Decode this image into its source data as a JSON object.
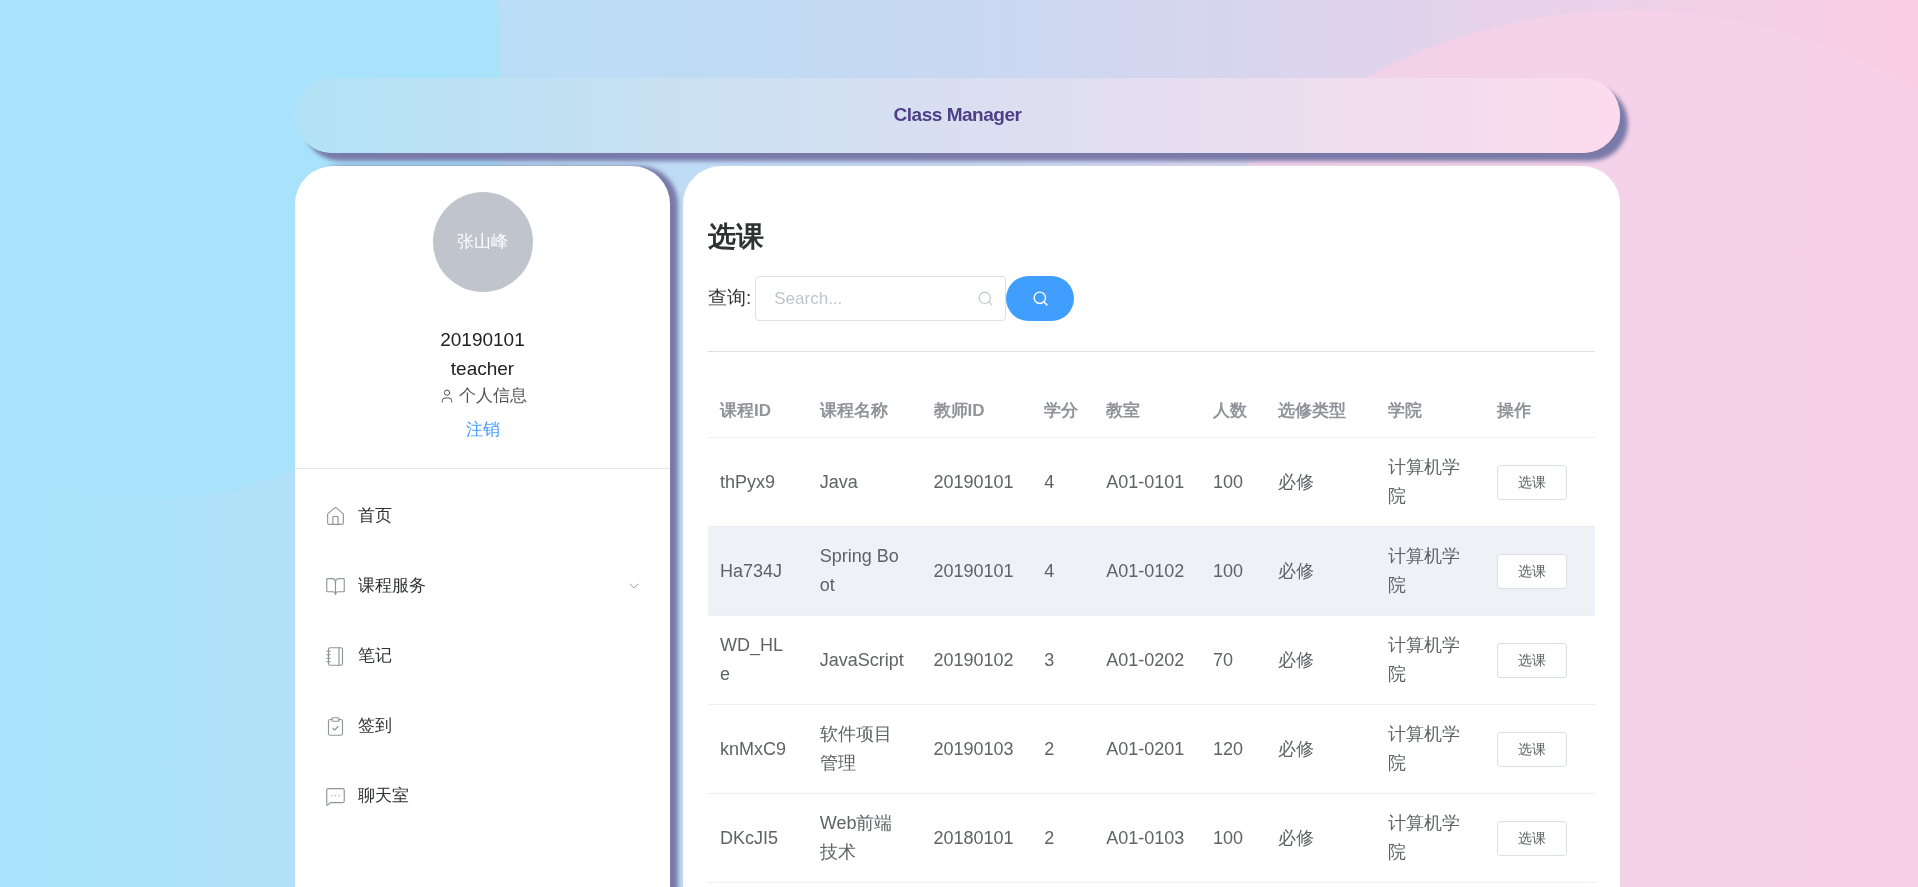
{
  "header": {
    "title": "Class Manager"
  },
  "profile": {
    "avatar_text": "张山峰",
    "user_id": "20190101",
    "role": "teacher",
    "info_link": "个人信息",
    "logout": "注销"
  },
  "menu": [
    {
      "label": "首页",
      "kind": "link"
    },
    {
      "label": "课程服务",
      "kind": "submenu",
      "expanded": false
    },
    {
      "label": "笔记",
      "kind": "link"
    },
    {
      "label": "签到",
      "kind": "link"
    },
    {
      "label": "聊天室",
      "kind": "link"
    }
  ],
  "page": {
    "title": "选课",
    "search_label": "查询:",
    "search": {
      "placeholder": "Search..."
    }
  },
  "table": {
    "columns": [
      "课程ID",
      "课程名称",
      "教师ID",
      "学分",
      "教室",
      "人数",
      "选修类型",
      "学院",
      "操作"
    ],
    "rows": [
      {
        "cells": [
          "thPyx9",
          "Java",
          "20190101",
          "4",
          "A01-0101",
          "100",
          "必修",
          "计算机学院"
        ],
        "action": "选课",
        "hovered": false
      },
      {
        "cells": [
          "Ha734J",
          "Spring Boot",
          "20190101",
          "4",
          "A01-0102",
          "100",
          "必修",
          "计算机学院"
        ],
        "action": "选课",
        "hovered": true
      },
      {
        "cells": [
          "WD_HLe",
          "JavaScript",
          "20190102",
          "3",
          "A01-0202",
          "70",
          "必修",
          "计算机学院"
        ],
        "action": "选课",
        "hovered": false
      },
      {
        "cells": [
          "knMxC9",
          "软件项目管理",
          "20190103",
          "2",
          "A01-0201",
          "120",
          "必修",
          "计算机学院"
        ],
        "action": "选课",
        "hovered": false
      },
      {
        "cells": [
          "DKcJI5",
          "Web前端技术",
          "20180101",
          "2",
          "A01-0103",
          "100",
          "必修",
          "计算机学院"
        ],
        "action": "选课",
        "hovered": false
      }
    ]
  }
}
